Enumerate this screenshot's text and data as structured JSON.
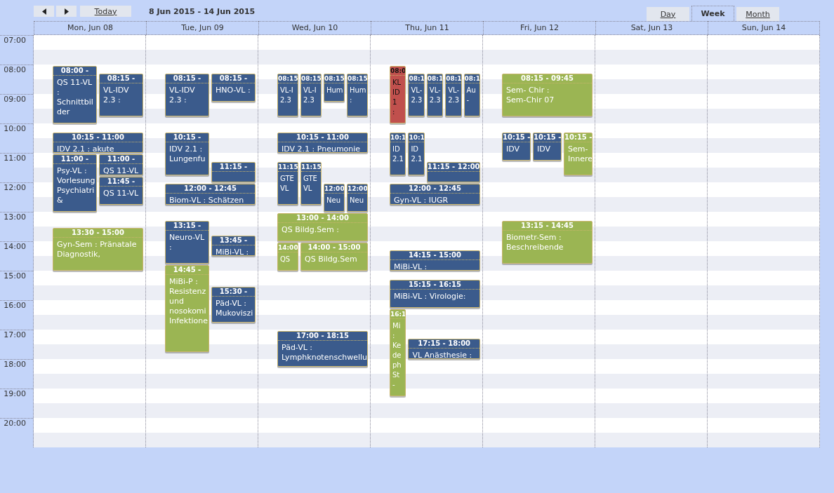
{
  "toolbar": {
    "today": "Today",
    "range": "8 Jun 2015 - 14 Jun 2015"
  },
  "views": [
    {
      "label": "Day",
      "selected": false
    },
    {
      "label": "Week",
      "selected": true
    },
    {
      "label": "Month",
      "selected": false
    }
  ],
  "hours": [
    "07:00",
    "08:00",
    "09:00",
    "10:00",
    "11:00",
    "12:00",
    "13:00",
    "14:00",
    "15:00",
    "16:00",
    "17:00",
    "18:00",
    "19:00",
    "20:00"
  ],
  "days": [
    {
      "label": "Mon, Jun 08",
      "events": [
        {
          "time": "08:00 -",
          "text": "QS 11-VL\n:\nSchnittbil\nder",
          "kind": "lecture",
          "color": "#3b5b8c"
        },
        {
          "time": "08:15 -",
          "text": "VL-IDV\n2.3 :",
          "kind": "lecture",
          "color": "#3b5b8c"
        },
        {
          "time": "10:15 - 11:00",
          "text": "IDV 2.1 : akute",
          "kind": "lecture",
          "color": "#3b5b8c"
        },
        {
          "time": "11:00 -",
          "text": "Psy-VL :\nVorlesung\nPsychiatri\n&",
          "kind": "lecture",
          "color": "#3b5b8c"
        },
        {
          "time": "11:00 -",
          "text": "QS 11-VL",
          "kind": "lecture",
          "color": "#3b5b8c"
        },
        {
          "time": "11:45 -",
          "text": "QS 11-VL",
          "kind": "lecture",
          "color": "#3b5b8c"
        },
        {
          "time": "13:30 - 15:00",
          "text": "Gyn-Sem : Pränatale\nDiagnostik,",
          "kind": "seminar",
          "color": "#9bb553"
        }
      ]
    },
    {
      "label": "Tue, Jun 09",
      "events": [
        {
          "time": "08:15 -",
          "text": "VL-IDV\n2.3 :",
          "kind": "lecture",
          "color": "#3b5b8c"
        },
        {
          "time": "08:15 -",
          "text": "HNO-VL :",
          "kind": "lecture",
          "color": "#3b5b8c"
        },
        {
          "time": "10:15 -",
          "text": "IDV 2.1 :\nLungenfu",
          "kind": "lecture",
          "color": "#3b5b8c"
        },
        {
          "time": "11:15 -",
          "kind": "lecture",
          "color": "#3b5b8c"
        },
        {
          "time": "12:00 - 12:45",
          "text": "Biom-VL : Schätzen",
          "kind": "lecture",
          "color": "#3b5b8c"
        },
        {
          "time": "13:15 -",
          "text": "Neuro-VL\n:",
          "kind": "lecture",
          "color": "#3b5b8c"
        },
        {
          "time": "13:45 -",
          "text": "MiBi-VL :",
          "kind": "lecture",
          "color": "#3b5b8c"
        },
        {
          "time": "14:45 -",
          "text": "MiBi-P :\nResistenz\nund\nnosokomi\nInfektione",
          "kind": "seminar",
          "color": "#9bb553"
        },
        {
          "time": "15:30 -",
          "text": "Päd-VL :\nMukoviszi",
          "kind": "lecture",
          "color": "#3b5b8c"
        }
      ]
    },
    {
      "label": "Wed, Jun 10",
      "events": [
        {
          "time": "08:15",
          "text": "VL-I\n2.3",
          "kind": "lecture",
          "color": "#3b5b8c"
        },
        {
          "time": "08:15",
          "text": "VL-I\n2.3",
          "kind": "lecture",
          "color": "#3b5b8c"
        },
        {
          "time": "08:15",
          "text": "Hum",
          "kind": "lecture",
          "color": "#3b5b8c"
        },
        {
          "time": "08:15",
          "text": "Hum\n:",
          "kind": "lecture",
          "color": "#3b5b8c"
        },
        {
          "time": "10:15 - 11:00",
          "text": "IDV 2.1 : Pneumonie",
          "kind": "lecture",
          "color": "#3b5b8c"
        },
        {
          "time": "11:15",
          "text": "GTE\nVL",
          "kind": "lecture",
          "color": "#3b5b8c"
        },
        {
          "time": "11:15",
          "text": "GTE\nVL",
          "kind": "lecture",
          "color": "#3b5b8c"
        },
        {
          "time": "12:00",
          "text": "Neu",
          "kind": "lecture",
          "color": "#3b5b8c"
        },
        {
          "time": "12:00",
          "text": "Neu",
          "kind": "lecture",
          "color": "#3b5b8c"
        },
        {
          "time": "13:00 - 14:00",
          "text": "QS Bildg.Sem :",
          "kind": "seminar",
          "color": "#9bb553"
        },
        {
          "time": "14:00",
          "text": "QS",
          "kind": "seminar",
          "color": "#9bb553"
        },
        {
          "time": "14:00 - 15:00",
          "text": "QS Bildg.Sem",
          "kind": "seminar",
          "color": "#9bb553"
        },
        {
          "time": "17:00 - 18:15",
          "text": "Päd-VL :\nLymphknotenschwellu",
          "kind": "lecture",
          "color": "#3b5b8c"
        }
      ]
    },
    {
      "label": "Thu, Jun 11",
      "events": [
        {
          "time": "08:0",
          "text": "KL\nID\n1\n:",
          "kind": "exam",
          "color": "#c0504d"
        },
        {
          "time": "08:1",
          "text": "VL-\n2.3",
          "kind": "lecture",
          "color": "#3b5b8c"
        },
        {
          "time": "08:1",
          "text": "VL-\n2.3",
          "kind": "lecture",
          "color": "#3b5b8c"
        },
        {
          "time": "08:1",
          "text": "VL-\n2.3",
          "kind": "lecture",
          "color": "#3b5b8c"
        },
        {
          "time": "08:1",
          "text": "Au\n-",
          "kind": "lecture",
          "color": "#3b5b8c"
        },
        {
          "time": "10:1",
          "text": "ID\n2.1",
          "kind": "lecture",
          "color": "#3b5b8c"
        },
        {
          "time": "10:1",
          "text": "ID\n2.1",
          "kind": "lecture",
          "color": "#3b5b8c"
        },
        {
          "time": "11:15 - 12:00",
          "kind": "lecture",
          "color": "#3b5b8c"
        },
        {
          "time": "12:00 - 12:45",
          "text": "Gyn-VL : IUGR",
          "kind": "lecture",
          "color": "#3b5b8c"
        },
        {
          "time": "14:15 - 15:00",
          "text": "MiBi-VL :",
          "kind": "lecture",
          "color": "#3b5b8c"
        },
        {
          "time": "15:15 - 16:15",
          "text": "MiBi-VL : Virologie:",
          "kind": "lecture",
          "color": "#3b5b8c"
        },
        {
          "time": "16:1",
          "text": "Mi\n:\nKe\nde\nph\nSt\n-",
          "kind": "seminar",
          "color": "#9bb553"
        },
        {
          "time": "17:15 - 18:00",
          "text": "VL Anästhesie :",
          "kind": "lecture",
          "color": "#3b5b8c"
        }
      ]
    },
    {
      "label": "Fri, Jun 12",
      "events": [
        {
          "time": "08:15 - 09:45",
          "text": "Sem- Chir :\nSem-Chir 07",
          "kind": "seminar",
          "color": "#9bb553"
        },
        {
          "time": "10:15 -",
          "text": "IDV",
          "kind": "lecture",
          "color": "#3b5b8c"
        },
        {
          "time": "10:15 -",
          "text": "IDV",
          "kind": "lecture",
          "color": "#3b5b8c"
        },
        {
          "time": "10:15 -",
          "text": "Sem-\nInnere",
          "kind": "seminar",
          "color": "#9bb553"
        },
        {
          "time": "13:15 - 14:45",
          "text": "Biometr-Sem :\nBeschreibende",
          "kind": "seminar",
          "color": "#9bb553"
        }
      ]
    },
    {
      "label": "Sat, Jun 13"
    },
    {
      "label": "Sun, Jun 14"
    }
  ]
}
